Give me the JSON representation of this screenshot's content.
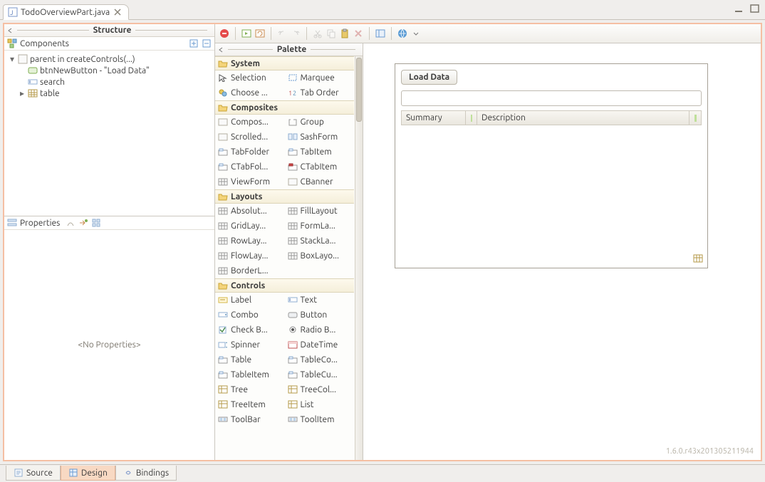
{
  "tab": {
    "title": "TodoOverviewPart.java"
  },
  "structure": {
    "title": "Structure",
    "components_label": "Components",
    "tree": {
      "root": "parent in createControls(...)",
      "children": [
        {
          "label": "btnNewButton - \"Load Data\"",
          "kind": "button"
        },
        {
          "label": "search",
          "kind": "text"
        },
        {
          "label": "table",
          "kind": "table",
          "expandable": true
        }
      ]
    },
    "properties_label": "Properties",
    "no_properties": "<No Properties>"
  },
  "palette": {
    "title": "Palette",
    "categories": [
      {
        "name": "System",
        "items": [
          "Selection",
          "Marquee",
          "Choose ...",
          "Tab Order"
        ]
      },
      {
        "name": "Composites",
        "items": [
          "Compos...",
          "Group",
          "Scrolled...",
          "SashForm",
          "TabFolder",
          "TabItem",
          "CTabFol...",
          "CTabItem",
          "ViewForm",
          "CBanner"
        ]
      },
      {
        "name": "Layouts",
        "items": [
          "Absolut...",
          "FillLayout",
          "GridLay...",
          "FormLa...",
          "RowLay...",
          "StackLa...",
          "FlowLay...",
          "BoxLayo...",
          "BorderL..."
        ]
      },
      {
        "name": "Controls",
        "items": [
          "Label",
          "Text",
          "Combo",
          "Button",
          "Check B...",
          "Radio B...",
          "Spinner",
          "DateTime",
          "Table",
          "TableCo...",
          "TableItem",
          "TableCu...",
          "Tree",
          "TreeCol...",
          "TreeItem",
          "List",
          "ToolBar",
          "ToolItem"
        ]
      }
    ]
  },
  "preview": {
    "button_label": "Load Data",
    "columns": [
      "Summary",
      "Description"
    ]
  },
  "bottom_tabs": [
    "Source",
    "Design",
    "Bindings"
  ],
  "version": "1.6.0.r43x201305211944"
}
